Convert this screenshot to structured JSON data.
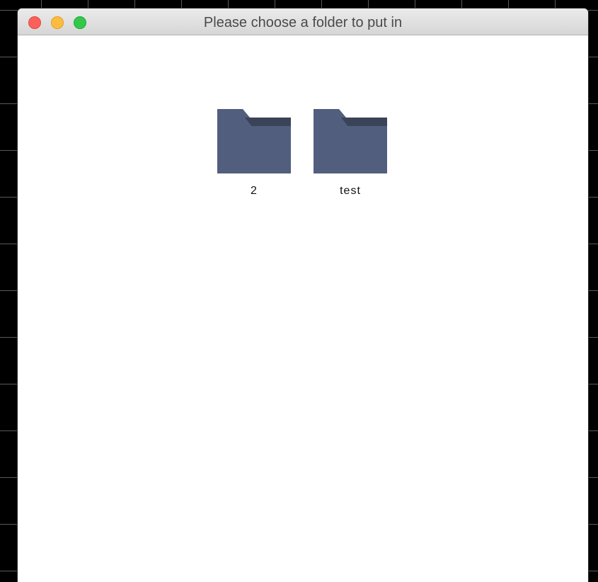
{
  "window": {
    "title": "Please choose a folder to put in",
    "controls": {
      "close": "close-button",
      "minimize": "minimize-button",
      "zoom": "zoom-button"
    }
  },
  "folders": [
    {
      "label": "2"
    },
    {
      "label": "test"
    }
  ],
  "colors": {
    "folder_body": "#525e7e",
    "folder_tab": "#3b4358",
    "close": "#fc605b",
    "minimize": "#fdbc40",
    "zoom": "#34c84a"
  }
}
